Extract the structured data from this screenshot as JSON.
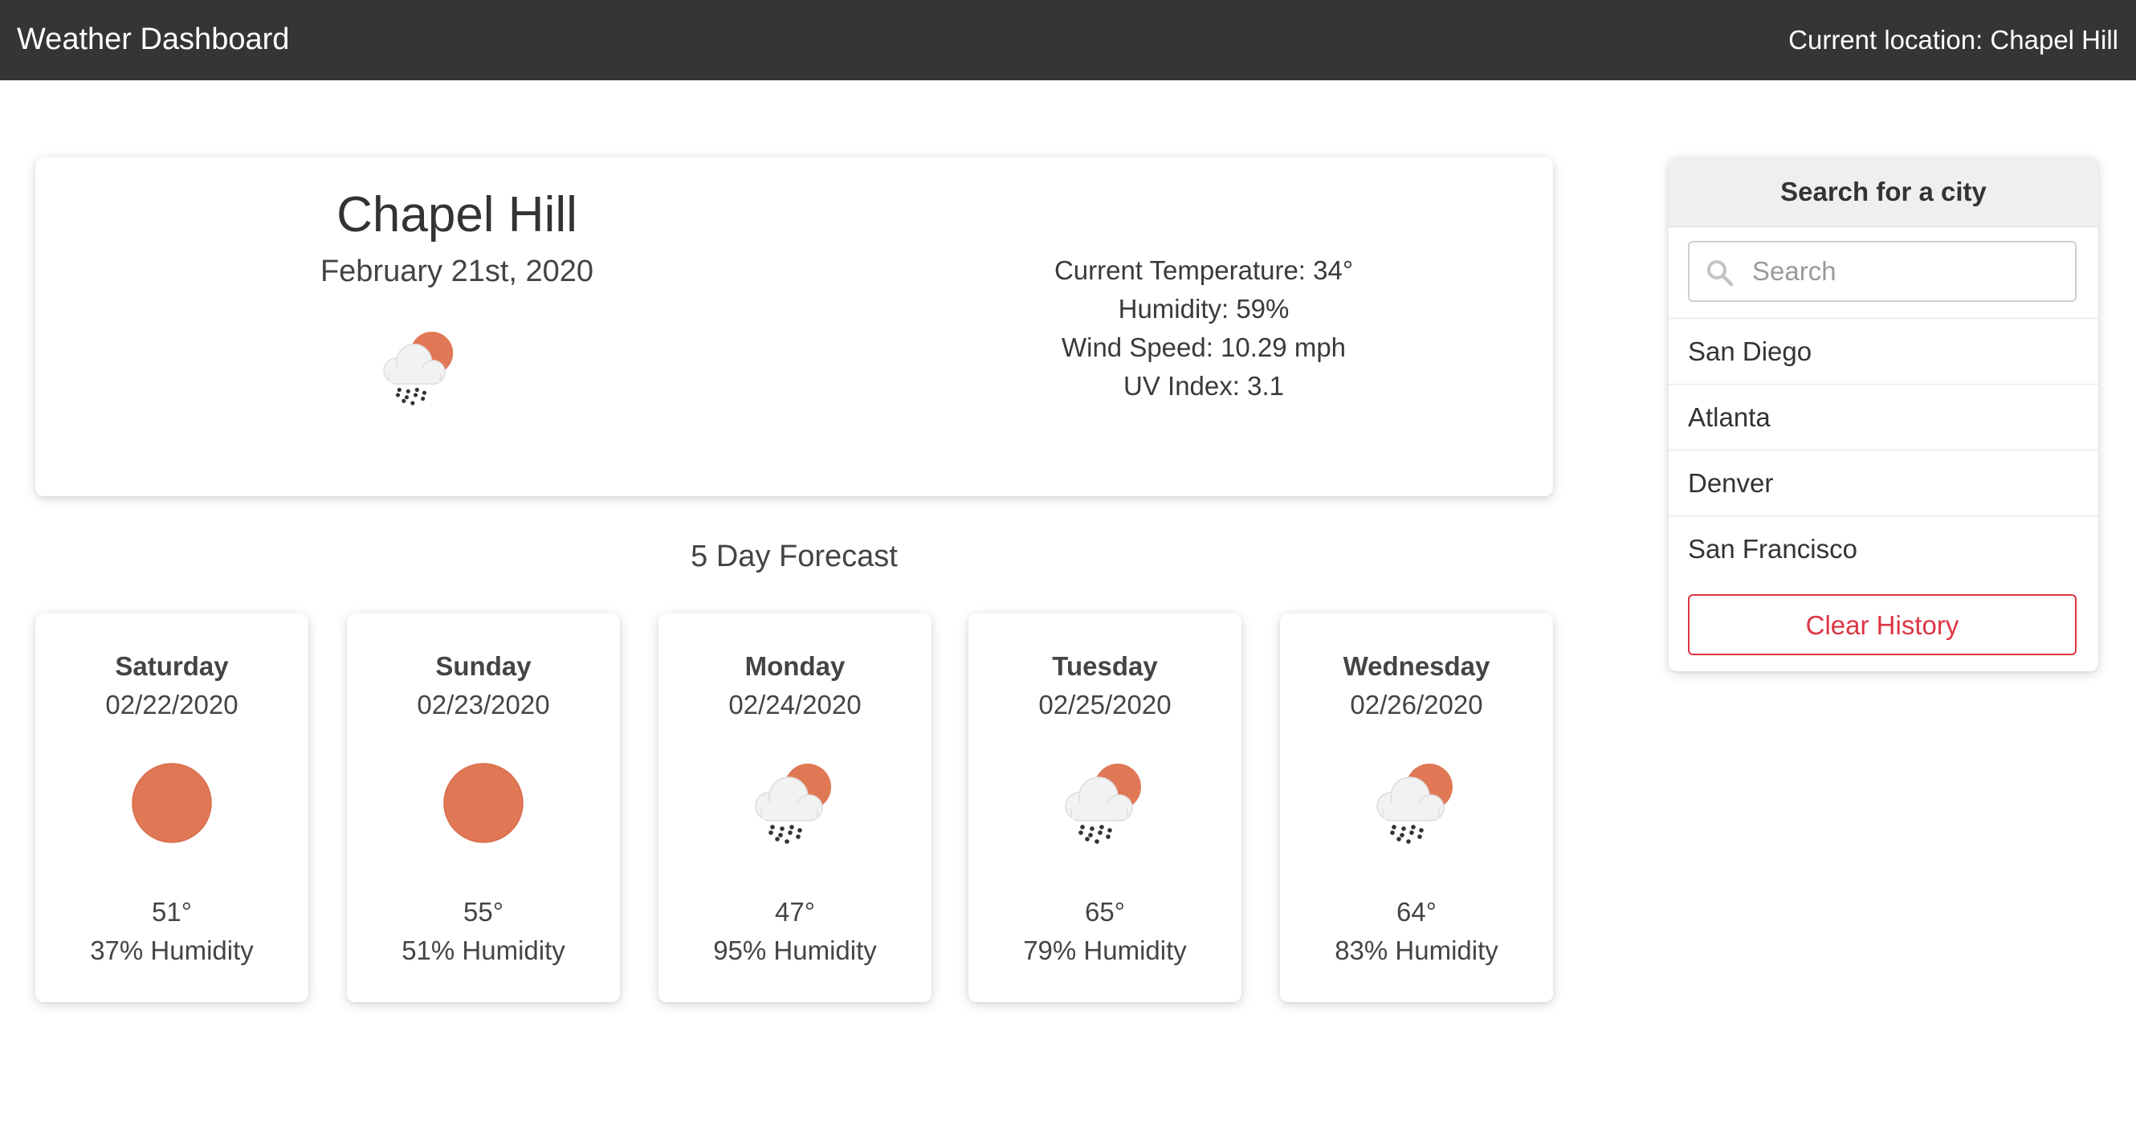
{
  "header": {
    "title": "Weather Dashboard",
    "location_text": "Current location: Chapel Hill"
  },
  "current": {
    "city": "Chapel Hill",
    "date": "February 21st, 2020",
    "icon": "rain-cloud-sun-icon",
    "temperature": "Current Temperature: 34°",
    "humidity": "Humidity: 59%",
    "wind": "Wind Speed: 10.29 mph",
    "uv": "UV Index: 3.1"
  },
  "forecast": {
    "title": "5 Day Forecast",
    "days": [
      {
        "day": "Saturday",
        "date": "02/22/2020",
        "icon": "sun-icon",
        "temp": "51°",
        "humidity": "37% Humidity"
      },
      {
        "day": "Sunday",
        "date": "02/23/2020",
        "icon": "sun-icon",
        "temp": "55°",
        "humidity": "51% Humidity"
      },
      {
        "day": "Monday",
        "date": "02/24/2020",
        "icon": "rain-cloud-sun-icon",
        "temp": "47°",
        "humidity": "95% Humidity"
      },
      {
        "day": "Tuesday",
        "date": "02/25/2020",
        "icon": "rain-cloud-sun-icon",
        "temp": "65°",
        "humidity": "79% Humidity"
      },
      {
        "day": "Wednesday",
        "date": "02/26/2020",
        "icon": "rain-cloud-sun-icon",
        "temp": "64°",
        "humidity": "83% Humidity"
      }
    ]
  },
  "search": {
    "header": "Search for a city",
    "placeholder": "Search",
    "value": "",
    "history": [
      "San Diego",
      "Atlanta",
      "Denver",
      "San Francisco"
    ],
    "clear_label": "Clear History"
  },
  "colors": {
    "navbar": "#353535",
    "sun": "#e07856",
    "danger": "#dc3545"
  }
}
